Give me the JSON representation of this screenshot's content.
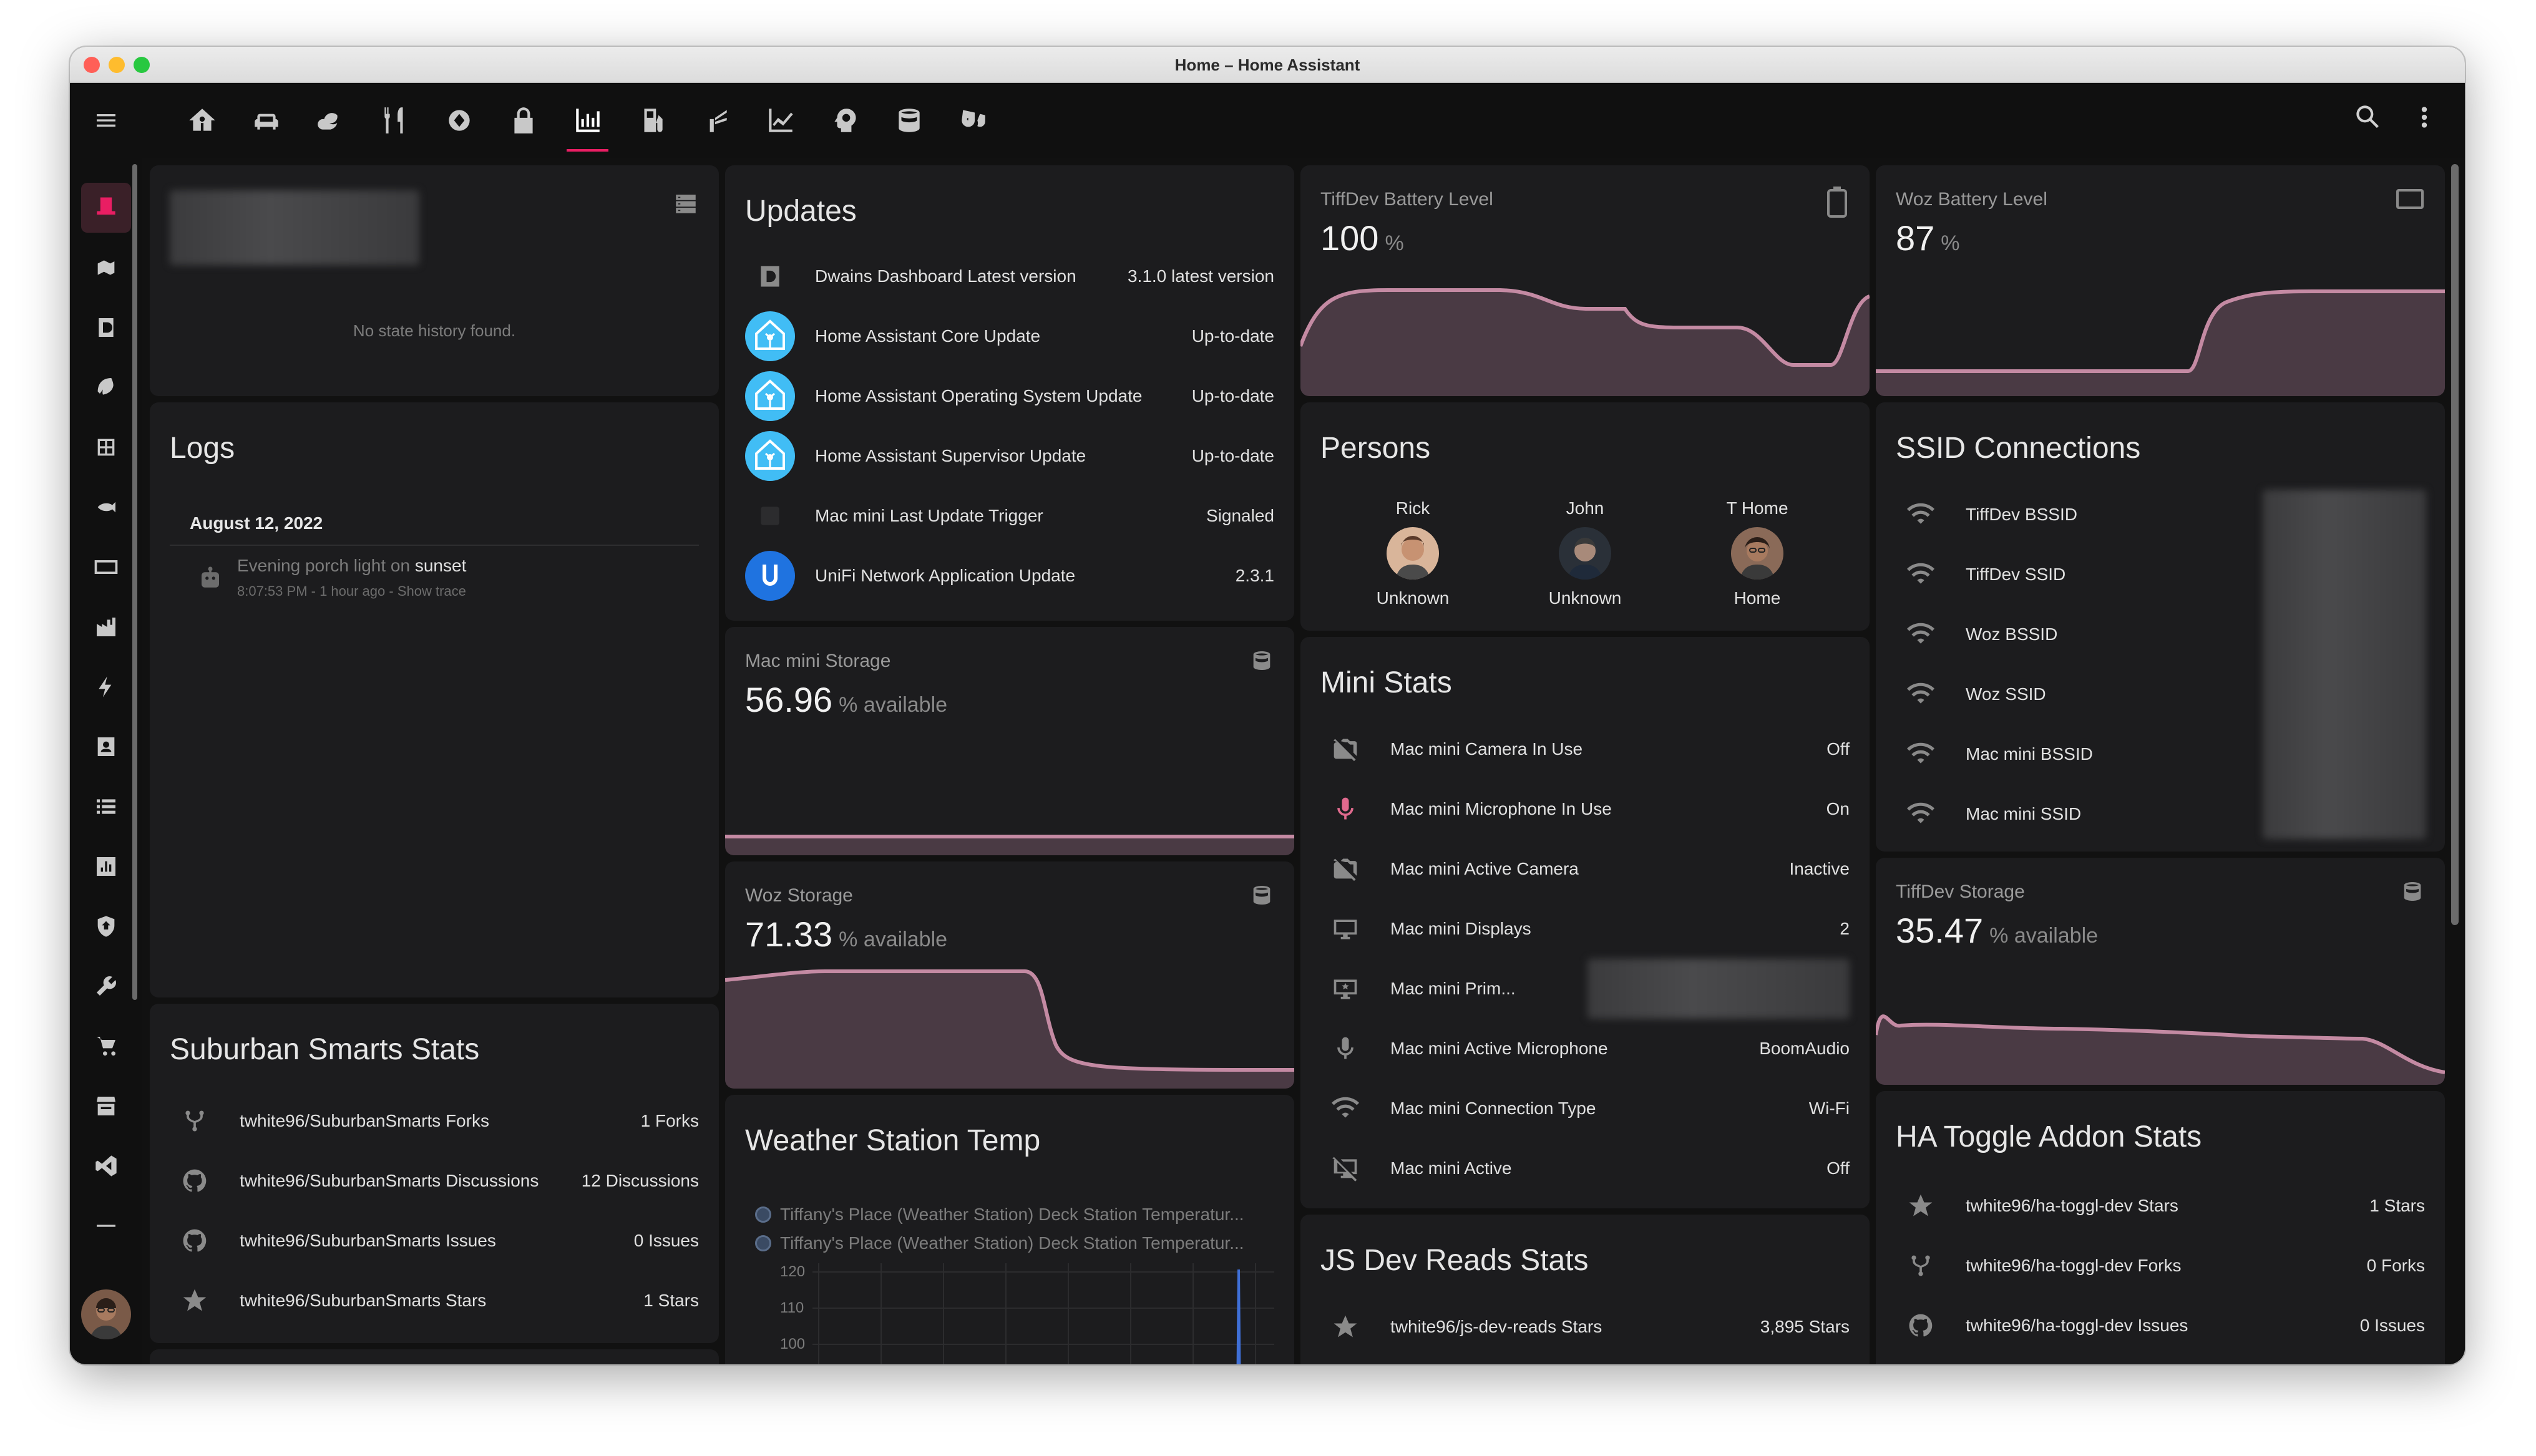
{
  "window": {
    "title": "Home – Home Assistant"
  },
  "colors": {
    "accent": "#e91e63",
    "graph_line": "#c48aa3",
    "graph_fill": "#4a3a44",
    "card": "#1c1c1e",
    "bg": "#111111"
  },
  "topbar": {
    "tabs": [
      {
        "icon": "home-account-icon"
      },
      {
        "icon": "sofa-icon"
      },
      {
        "icon": "weather-night-icon"
      },
      {
        "icon": "silverware-icon"
      },
      {
        "icon": "washing-machine-icon"
      },
      {
        "icon": "lock-icon"
      },
      {
        "icon": "chart-bar-icon",
        "active": true
      },
      {
        "icon": "gas-pump-icon"
      },
      {
        "icon": "sprinkler-icon"
      },
      {
        "icon": "chart-line-icon"
      },
      {
        "icon": "head-cog-icon"
      },
      {
        "icon": "database-icon"
      },
      {
        "icon": "drama-masks-icon"
      }
    ],
    "right": [
      {
        "icon": "search-icon"
      },
      {
        "icon": "dots-vertical-icon"
      }
    ]
  },
  "sidebar": {
    "items": [
      {
        "icon": "top-hat-icon",
        "active": true
      },
      {
        "icon": "map-marker-icon"
      },
      {
        "icon": "dashboard-icon"
      },
      {
        "icon": "leaf-icon"
      },
      {
        "icon": "table-icon"
      },
      {
        "icon": "fish-icon"
      },
      {
        "icon": "rectangle-icon"
      },
      {
        "icon": "factory-icon"
      },
      {
        "icon": "lightning-icon"
      },
      {
        "icon": "contact-card-icon"
      },
      {
        "icon": "list-icon"
      },
      {
        "icon": "chart-box-icon"
      },
      {
        "icon": "shield-home-icon"
      },
      {
        "icon": "wrench-icon"
      },
      {
        "icon": "cart-icon"
      },
      {
        "icon": "hacs-store-icon"
      },
      {
        "icon": "vscode-icon"
      },
      {
        "icon": "minus-icon"
      },
      {
        "icon": "bell-icon"
      }
    ]
  },
  "history_card": {
    "empty_text": "No state history found."
  },
  "logs": {
    "title": "Logs",
    "date": "August 12, 2022",
    "entry_prefix": "Evening porch light on",
    "entry_trigger": "sunset",
    "entry_meta": "8:07:53 PM - 1 hour ago - Show trace"
  },
  "suburban_stats": {
    "title": "Suburban Smarts Stats",
    "rows": [
      {
        "icon": "source-fork-icon",
        "name": "twhite96/SuburbanSmarts Forks",
        "value": "1 Forks"
      },
      {
        "icon": "github-icon",
        "name": "twhite96/SuburbanSmarts Discussions",
        "value": "12 Discussions"
      },
      {
        "icon": "github-icon",
        "name": "twhite96/SuburbanSmarts Issues",
        "value": "0 Issues"
      },
      {
        "icon": "star-icon",
        "name": "twhite96/SuburbanSmarts Stars",
        "value": "1 Stars"
      }
    ]
  },
  "updates": {
    "title": "Updates",
    "rows": [
      {
        "icon": "dwains-icon",
        "name": "Dwains Dashboard Latest version",
        "value": "3.1.0 latest version"
      },
      {
        "icon": "home-assistant-icon",
        "name": "Home Assistant Core Update",
        "value": "Up-to-date"
      },
      {
        "icon": "home-assistant-icon",
        "name": "Home Assistant Operating System Update",
        "value": "Up-to-date"
      },
      {
        "icon": "home-assistant-icon",
        "name": "Home Assistant Supervisor Update",
        "value": "Up-to-date"
      },
      {
        "icon": "blank-icon",
        "name": "Mac mini Last Update Trigger",
        "value": "Signaled"
      },
      {
        "icon": "unifi-icon",
        "name": "UniFi Network Application Update",
        "value": "2.3.1"
      }
    ]
  },
  "mac_storage": {
    "name": "Mac mini Storage",
    "value": "56.96",
    "unit": "% available",
    "icon": "database-icon"
  },
  "woz_storage": {
    "name": "Woz Storage",
    "value": "71.33",
    "unit": "% available",
    "icon": "database-icon"
  },
  "weather": {
    "title": "Weather Station Temp",
    "legend": [
      "Tiffany's Place (Weather Station) Deck Station Temperatur...",
      "Tiffany's Place (Weather Station) Deck Station Temperatur..."
    ],
    "y_ticks": [
      "120",
      "110",
      "100"
    ]
  },
  "tiffdev_battery": {
    "name": "TiffDev Battery Level",
    "value": "100",
    "unit": "%",
    "icon": "battery-icon"
  },
  "woz_battery": {
    "name": "Woz Battery Level",
    "value": "87",
    "unit": "%",
    "icon": "laptop-icon"
  },
  "persons": {
    "title": "Persons",
    "people": [
      {
        "name": "Rick",
        "state": "Unknown"
      },
      {
        "name": "John",
        "state": "Unknown"
      },
      {
        "name": "T Home",
        "state": "Home"
      }
    ]
  },
  "mini_stats": {
    "title": "Mini Stats",
    "rows": [
      {
        "icon": "camera-off-icon",
        "name": "Mac mini Camera In Use",
        "value": "Off"
      },
      {
        "icon": "microphone-icon",
        "name": "Mac mini Microphone In Use",
        "value": "On",
        "accent": true
      },
      {
        "icon": "camera-off-icon",
        "name": "Mac mini Active Camera",
        "value": "Inactive"
      },
      {
        "icon": "monitor-icon",
        "name": "Mac mini Displays",
        "value": "2"
      },
      {
        "icon": "monitor-star-icon",
        "name": "Mac mini Prim...",
        "value": ""
      },
      {
        "icon": "microphone-icon",
        "name": "Mac mini Active Microphone",
        "value": "BoomAudio"
      },
      {
        "icon": "wifi-icon",
        "name": "Mac mini Connection Type",
        "value": "Wi-Fi"
      },
      {
        "icon": "monitor-off-icon",
        "name": "Mac mini Active",
        "value": "Off"
      }
    ]
  },
  "js_dev": {
    "title": "JS Dev Reads Stats",
    "rows": [
      {
        "icon": "star-icon",
        "name": "twhite96/js-dev-reads Stars",
        "value": "3,895 Stars"
      }
    ]
  },
  "ssid": {
    "title": "SSID Connections",
    "rows": [
      {
        "icon": "wifi-star-icon",
        "name": "TiffDev BSSID"
      },
      {
        "icon": "wifi-icon",
        "name": "TiffDev SSID"
      },
      {
        "icon": "wifi-star-icon",
        "name": "Woz BSSID"
      },
      {
        "icon": "wifi-icon",
        "name": "Woz SSID"
      },
      {
        "icon": "wifi-star-icon",
        "name": "Mac mini BSSID"
      },
      {
        "icon": "wifi-icon",
        "name": "Mac mini SSID"
      }
    ]
  },
  "tiffdev_storage": {
    "name": "TiffDev Storage",
    "value": "35.47",
    "unit": "% available",
    "icon": "database-icon"
  },
  "toggl_stats": {
    "title": "HA Toggle Addon Stats",
    "rows": [
      {
        "icon": "star-icon",
        "name": "twhite96/ha-toggl-dev Stars",
        "value": "1 Stars"
      },
      {
        "icon": "source-fork-icon",
        "name": "twhite96/ha-toggl-dev Forks",
        "value": "0 Forks"
      },
      {
        "icon": "github-icon",
        "name": "twhite96/ha-toggl-dev Issues",
        "value": "0 Issues"
      }
    ]
  }
}
